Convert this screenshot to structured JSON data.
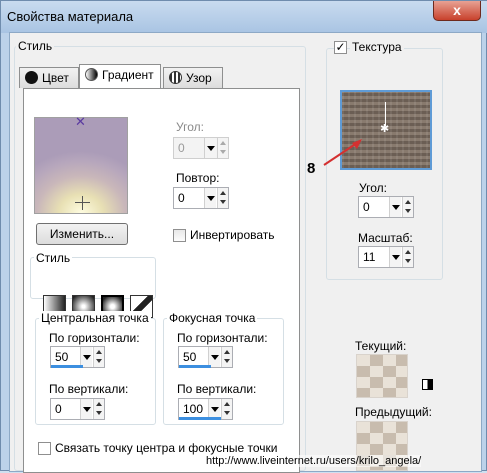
{
  "window": {
    "title": "Свойства материала",
    "close_glyph": "x"
  },
  "style_group": {
    "label": "Стиль"
  },
  "tabs": [
    {
      "label": "Цвет"
    },
    {
      "label": "Градиент"
    },
    {
      "label": "Узор"
    }
  ],
  "gradient": {
    "angle_label": "Угол:",
    "angle_value": "0",
    "repeat_label": "Повтор:",
    "repeat_value": "0",
    "edit_button": "Изменить...",
    "invert_label": "Инвертировать",
    "invert_checked": false,
    "style_label": "Стиль",
    "center": {
      "label": "Центральная точка",
      "h_label": "По горизонтали:",
      "h_value": "50",
      "v_label": "По вертикали:",
      "v_value": "0"
    },
    "focus": {
      "label": "Фокусная точка",
      "h_label": "По горизонтали:",
      "h_value": "50",
      "v_label": "По вертикали:",
      "v_value": "100"
    },
    "link_label": "Связать точку центра и фокусные точки",
    "link_checked": false
  },
  "texture": {
    "label": "Текстура",
    "checked": true,
    "annotation": "8",
    "angle_label": "Угол:",
    "angle_value": "0",
    "scale_label": "Масштаб:",
    "scale_value": "11"
  },
  "current_label": "Текущий:",
  "previous_label": "Предыдущий:",
  "watermark": "http://www.liveinternet.ru/users/krilo_angela/",
  "colors": {
    "accent": "#3c8fe0",
    "annotation_arrow": "#d43030",
    "titlebar": "#a9c4e3"
  }
}
